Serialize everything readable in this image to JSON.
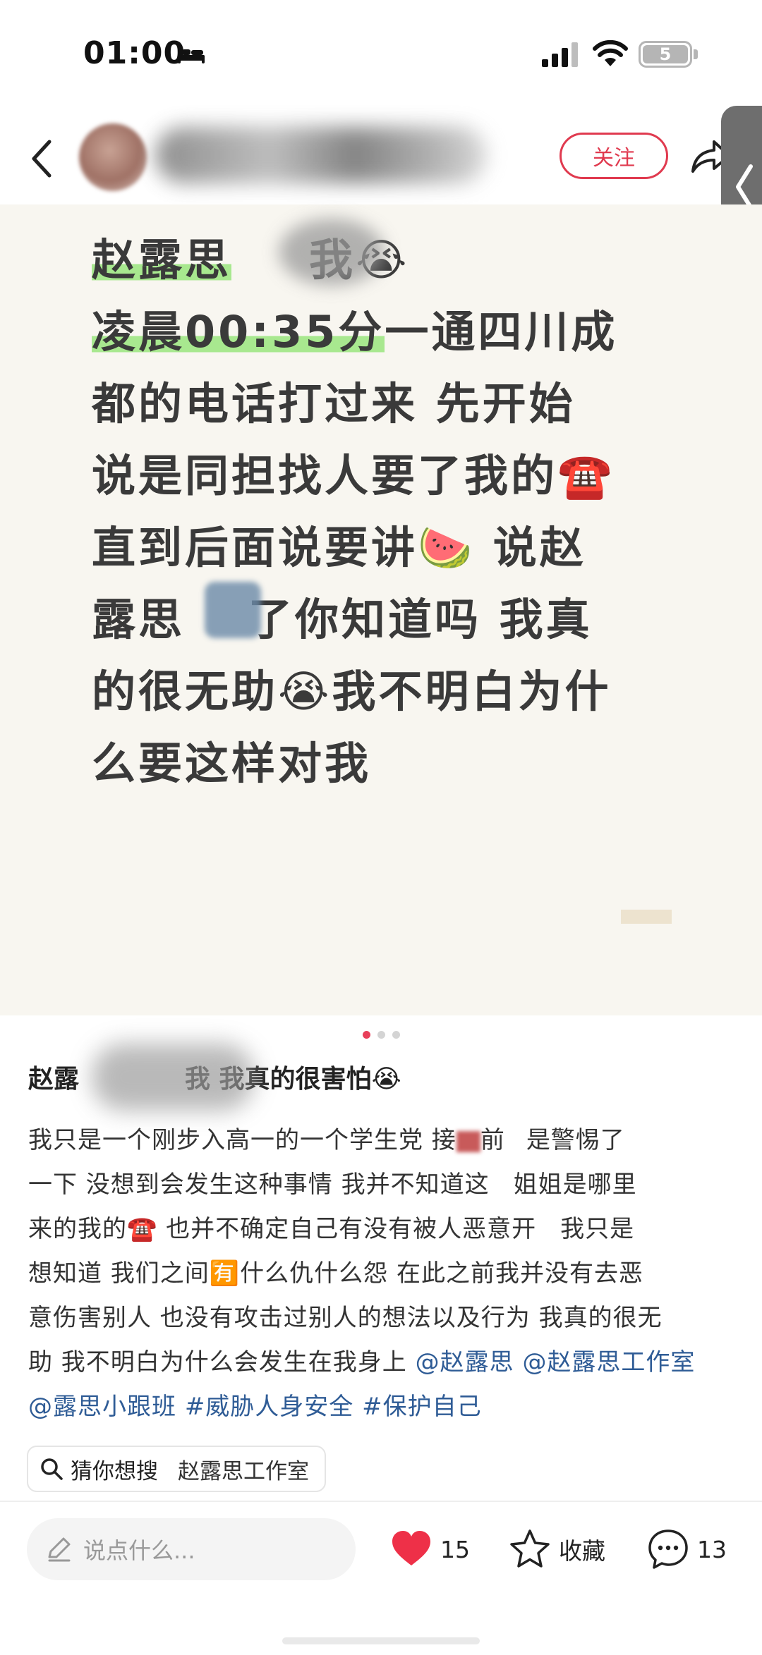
{
  "status_bar": {
    "time": "01:00",
    "battery": "5"
  },
  "nav": {
    "follow_label": "关注"
  },
  "image_card": {
    "line1_a": "赵露思",
    "line1_b": "我",
    "line2_a": "凌晨00:35分",
    "line2_b": "一通四川成",
    "line3": "都的电话打过来 先开始",
    "line4": "说是同担找人要了我的",
    "line5_a": "直到后面说要讲",
    "line5_b": " 说赵",
    "line6_a": "露思",
    "line6_b": "了你知道吗 我真",
    "line7_a": "的很无助",
    "line7_b": "我不明白为什",
    "line8": "么要这样对我",
    "emoji_cry": "😭",
    "emoji_phone": "☎️",
    "emoji_watermelon": "🍉"
  },
  "pager": {
    "count": 3,
    "active": 0
  },
  "note": {
    "title_a": "赵露",
    "title_b": "我 我真的很害怕",
    "title_emoji": "😭",
    "body_1": "我只是一个刚步入高一的一个学生党 接",
    "body_2": "前",
    "body_3": "是警惕了",
    "body_4": "一下 没想到会发生这种事情 我并不知道这",
    "body_5": "姐姐是哪里",
    "body_6": "来的我的",
    "body_7": " 也并不确定自己有没有被人恶意开",
    "body_8": "我只是",
    "body_9": "想知道 我们之间",
    "body_10": "什么仇什么怨 在此之前我并没有去恶",
    "body_11": "意伤害别人 也没有攻击过别人的想法以及行为 我真的很无",
    "body_12": "助 我不明白为什么会发生在我身上 ",
    "emoji_you": "🈶",
    "mentions": [
      "@赵露思",
      "@赵露思工作室",
      "@露思小跟班"
    ],
    "hashtags": [
      "#威胁人身安全",
      "#保护自己"
    ]
  },
  "search_suggestion": {
    "label": "猜你想搜",
    "query": "赵露思工作室"
  },
  "bottom_bar": {
    "comment_placeholder": "说点什么...",
    "likes": "15",
    "collect_label": "收藏",
    "comments": "13"
  },
  "colors": {
    "accent": "#e03a4f",
    "hashtag": "#2f5c96",
    "highlight": "#a8e88f"
  }
}
